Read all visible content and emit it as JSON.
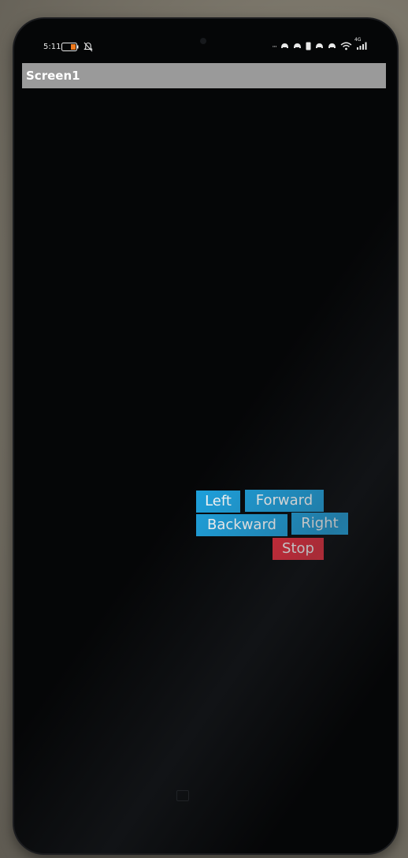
{
  "status_bar": {
    "time": "5:11",
    "network": "4G",
    "overflow": "···"
  },
  "app": {
    "title": "Screen1"
  },
  "controls": {
    "left_label": "Left",
    "forward_label": "Forward",
    "backward_label": "Backward",
    "right_label": "Right",
    "stop_label": "Stop"
  },
  "colors": {
    "button_blue": "#1ea2de",
    "button_red": "#ec2b3a",
    "titlebar": "#9a9a9a",
    "screen": "#050607"
  },
  "icons": {
    "status_left": [
      "battery-saver-icon",
      "notifications-muted-icon"
    ],
    "status_right": [
      "more-icon",
      "app-notification-icon",
      "app-notification-icon",
      "sim-icon",
      "app-notification-icon",
      "app-notification-icon",
      "wifi-icon",
      "signal-icon"
    ]
  }
}
